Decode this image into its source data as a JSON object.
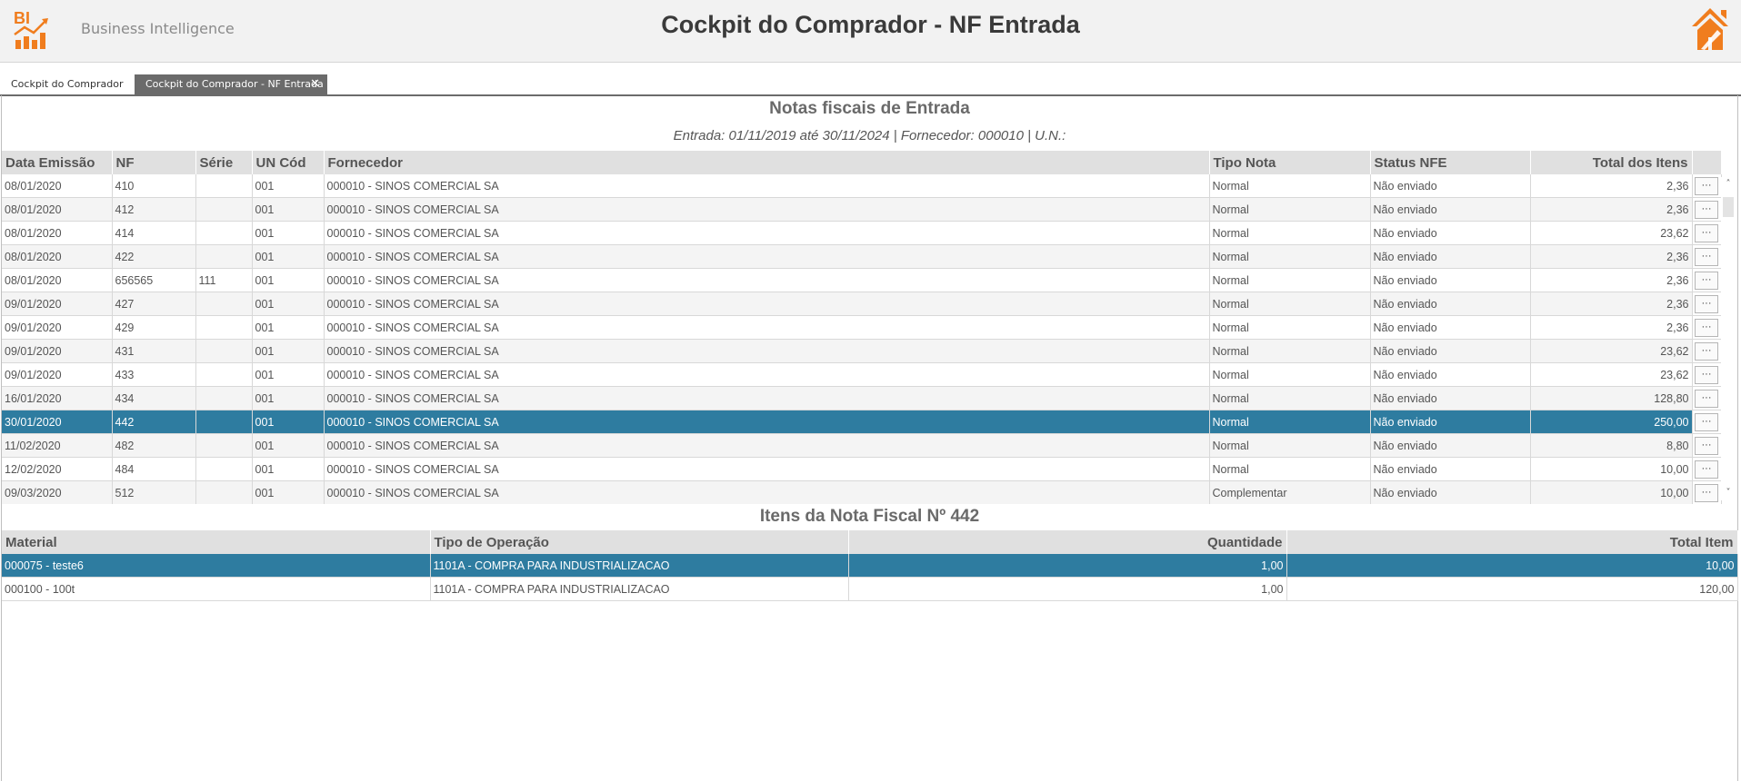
{
  "header": {
    "logo_text": "BI",
    "brand": "Business Intelligence",
    "title": "Cockpit do Comprador - NF Entrada"
  },
  "colors": {
    "accent": "#f07d1e",
    "selection": "#2e7ca0",
    "header_bg": "#e0e0e0"
  },
  "tabs": [
    {
      "label": "Cockpit do Comprador"
    },
    {
      "label": "Cockpit do Comprador - NF Entrada",
      "close": "✕"
    }
  ],
  "nf_section": {
    "title": "Notas fiscais de Entrada",
    "subtitle": "Entrada: 01/11/2019 até 30/11/2024 | Fornecedor: 000010 | U.N.:",
    "columns": [
      "Data Emissão",
      "NF",
      "Série",
      "UN Cód",
      "Fornecedor",
      "Tipo Nota",
      "Status NFE",
      "Total dos Itens"
    ],
    "action_label": "···",
    "rows": [
      [
        "08/01/2020",
        "410",
        "",
        "001",
        "000010 - SINOS COMERCIAL SA",
        "Normal",
        "Não enviado",
        "2,36"
      ],
      [
        "08/01/2020",
        "412",
        "",
        "001",
        "000010 - SINOS COMERCIAL SA",
        "Normal",
        "Não enviado",
        "2,36"
      ],
      [
        "08/01/2020",
        "414",
        "",
        "001",
        "000010 - SINOS COMERCIAL SA",
        "Normal",
        "Não enviado",
        "23,62"
      ],
      [
        "08/01/2020",
        "422",
        "",
        "001",
        "000010 - SINOS COMERCIAL SA",
        "Normal",
        "Não enviado",
        "2,36"
      ],
      [
        "08/01/2020",
        "656565",
        "111",
        "001",
        "000010 - SINOS COMERCIAL SA",
        "Normal",
        "Não enviado",
        "2,36"
      ],
      [
        "09/01/2020",
        "427",
        "",
        "001",
        "000010 - SINOS COMERCIAL SA",
        "Normal",
        "Não enviado",
        "2,36"
      ],
      [
        "09/01/2020",
        "429",
        "",
        "001",
        "000010 - SINOS COMERCIAL SA",
        "Normal",
        "Não enviado",
        "2,36"
      ],
      [
        "09/01/2020",
        "431",
        "",
        "001",
        "000010 - SINOS COMERCIAL SA",
        "Normal",
        "Não enviado",
        "23,62"
      ],
      [
        "09/01/2020",
        "433",
        "",
        "001",
        "000010 - SINOS COMERCIAL SA",
        "Normal",
        "Não enviado",
        "23,62"
      ],
      [
        "16/01/2020",
        "434",
        "",
        "001",
        "000010 - SINOS COMERCIAL SA",
        "Normal",
        "Não enviado",
        "128,80"
      ],
      [
        "30/01/2020",
        "442",
        "",
        "001",
        "000010 - SINOS COMERCIAL SA",
        "Normal",
        "Não enviado",
        "250,00"
      ],
      [
        "11/02/2020",
        "482",
        "",
        "001",
        "000010 - SINOS COMERCIAL SA",
        "Normal",
        "Não enviado",
        "8,80"
      ],
      [
        "12/02/2020",
        "484",
        "",
        "001",
        "000010 - SINOS COMERCIAL SA",
        "Normal",
        "Não enviado",
        "10,00"
      ],
      [
        "09/03/2020",
        "512",
        "",
        "001",
        "000010 - SINOS COMERCIAL SA",
        "Complementar",
        "Não enviado",
        "10,00"
      ]
    ],
    "selected_row": 10
  },
  "items_section": {
    "title": "Itens da Nota Fiscal Nº 442",
    "columns": [
      "Material",
      "Tipo de Operação",
      "Quantidade",
      "Total Item"
    ],
    "rows": [
      [
        "000075 - teste6",
        "1101A - COMPRA PARA INDUSTRIALIZACAO",
        "1,00",
        "10,00"
      ],
      [
        "000100 - 100t",
        "1101A - COMPRA PARA INDUSTRIALIZACAO",
        "1,00",
        "120,00"
      ]
    ],
    "selected_row": 0
  },
  "scrollbar": {
    "up": "˄",
    "down": "˅"
  }
}
